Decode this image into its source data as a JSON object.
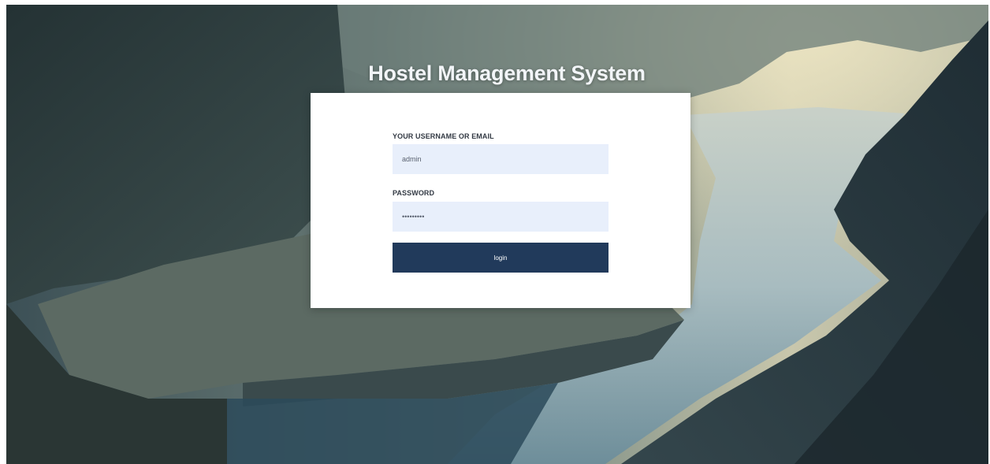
{
  "page": {
    "title": "Hostel Management System"
  },
  "login_form": {
    "username_label": "YOUR USERNAME OR EMAIL",
    "username_value": "admin",
    "password_label": "PASSWORD",
    "password_value": "password1",
    "submit_label": "login"
  },
  "colors": {
    "button": "#213a5b",
    "input_background": "#e8effb",
    "card": "#ffffff"
  }
}
